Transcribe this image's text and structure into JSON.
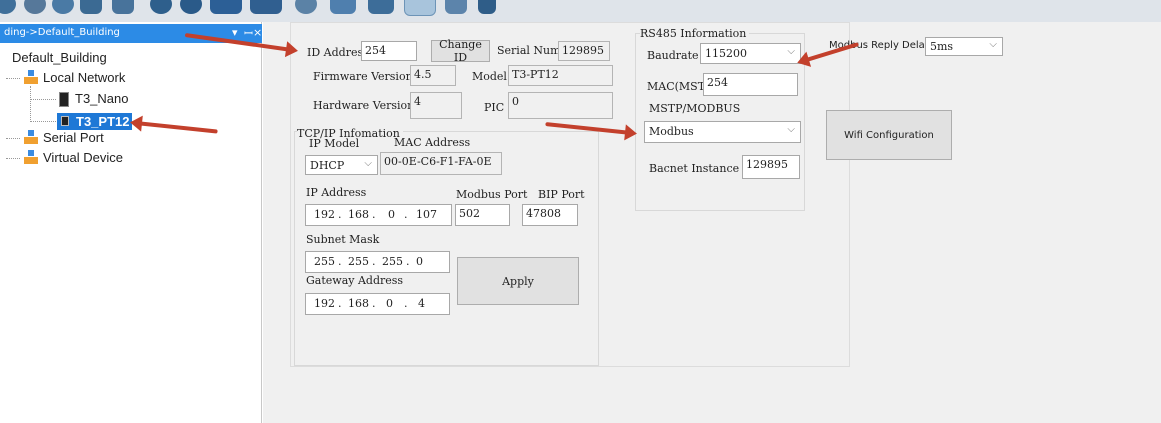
{
  "toolbar": {
    "icons": [
      "navigate-back-icon",
      "navigate-forward-icon",
      "globe-icon",
      "home-icon",
      "refresh-icon",
      "gear-icon",
      "globe-network-icon",
      "grid-icon",
      "table-icon",
      "wave-icon",
      "chart-icon",
      "monitor-icon",
      "settings-gear-icon",
      "search-icon",
      "book-icon"
    ]
  },
  "tree": {
    "header": "ding->Default_Building",
    "header_controls": [
      "▾",
      "ꟷ",
      "×"
    ],
    "root": "Default_Building",
    "local_network": "Local Network",
    "t3_nano": "T3_Nano",
    "t3_pt12": "T3_PT12",
    "serial_port": "Serial Port",
    "virtual_device": "Virtual Device"
  },
  "device": {
    "id_address_label": "ID Address",
    "id_address": "254",
    "change_id_button": "Change ID",
    "serial_number_label": "Serial Number",
    "serial_number": "129895",
    "firmware_version_label": "Firmware Version",
    "firmware_version": "4.5",
    "model_label": "Model",
    "model": "T3-PT12",
    "hardware_version_label": "Hardware Version",
    "hardware_version": "4",
    "pic_label": "PIC",
    "pic": "0"
  },
  "tcpip": {
    "group_title": "TCP/IP Infomation",
    "ip_model_label": "IP Model",
    "mac_address_label": "MAC Address",
    "ip_model": "DHCP",
    "mac_address": "00-0E-C6-F1-FA-0E",
    "ip_address_label": "IP Address",
    "modbus_port_label": "Modbus Port",
    "bip_port_label": "BIP Port",
    "ip_address": [
      "192",
      "168",
      "0",
      "107"
    ],
    "modbus_port": "502",
    "bip_port": "47808",
    "subnet_mask_label": "Subnet Mask",
    "subnet_mask": [
      "255",
      "255",
      "255",
      "0"
    ],
    "gateway_label": "Gateway Address",
    "gateway": [
      "192",
      "168",
      "0",
      "4"
    ],
    "apply_button": "Apply"
  },
  "rs485": {
    "group_title": "RS485 Information",
    "baudrate_label": "Baudrate",
    "baudrate": "115200",
    "mac_mstp_label": "MAC(MSTP)",
    "mac_mstp": "254",
    "mstp_modbus_label": "MSTP/MODBUS",
    "protocol": "Modbus",
    "bacnet_instance_label": "Bacnet Instance :",
    "bacnet_instance": "129895"
  },
  "modbus_reply_delay": {
    "label": "Modbus Reply Delay",
    "value": "5ms"
  },
  "wifi_button": "Wifi Configuration",
  "colors": {
    "tree_header": "#2c8be6",
    "selected_item": "#1e78d6",
    "arrow": "#c3402c",
    "panel": "#f0f0f0"
  }
}
